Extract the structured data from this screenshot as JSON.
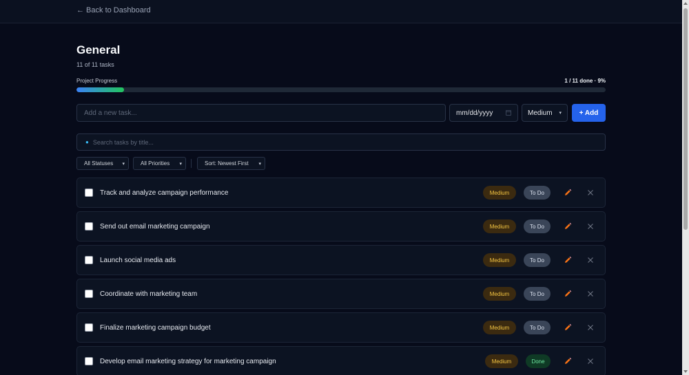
{
  "nav": {
    "back_label": "← Back to Dashboard"
  },
  "header": {
    "title": "General",
    "task_count": "11 of 11 tasks"
  },
  "progress": {
    "label": "Project Progress",
    "stats": "1 / 11 done · 9%",
    "fraction": 0.09
  },
  "add_form": {
    "task_placeholder": "Add a new task...",
    "date_value": "mm/dd/yyyy",
    "priority_value": "Medium",
    "add_label": "+ Add"
  },
  "search": {
    "placeholder": "Search tasks by title...",
    "icon": "search-icon"
  },
  "filters": {
    "status": "All Statuses",
    "priority": "All Priorities",
    "sort": "Sort: Newest First"
  },
  "tasks": [
    {
      "title": "Track and analyze campaign performance",
      "priority": "Medium",
      "status": "To Do"
    },
    {
      "title": "Send out email marketing campaign",
      "priority": "Medium",
      "status": "To Do"
    },
    {
      "title": "Launch social media ads",
      "priority": "Medium",
      "status": "To Do"
    },
    {
      "title": "Coordinate with marketing team",
      "priority": "Medium",
      "status": "To Do"
    },
    {
      "title": "Finalize marketing campaign budget",
      "priority": "Medium",
      "status": "To Do"
    },
    {
      "title": "Develop email marketing strategy for marketing campaign",
      "priority": "Medium",
      "status": "Done"
    }
  ],
  "colors": {
    "background": "#070b1a",
    "accent": "#2563eb",
    "progress_start": "#3b82f6",
    "progress_end": "#22c55e",
    "priority_medium_text": "#f4c542",
    "status_done_text": "#6ee7a1",
    "edit_icon": "#f97316"
  },
  "icons": {
    "edit": "pencil-icon",
    "delete": "close-icon",
    "calendar": "calendar-icon"
  }
}
